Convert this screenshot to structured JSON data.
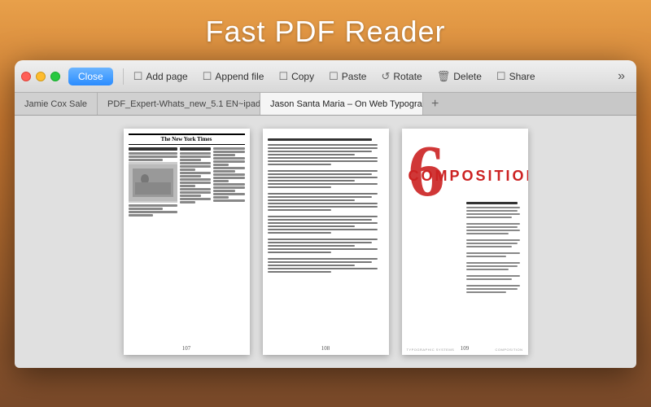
{
  "appTitle": "Fast PDF Reader",
  "toolbar": {
    "closeBtn": "Close",
    "buttons": [
      {
        "id": "add-page",
        "icon": "☐",
        "label": "Add page"
      },
      {
        "id": "append-file",
        "icon": "☐",
        "label": "Append file"
      },
      {
        "id": "copy",
        "icon": "☐",
        "label": "Copy"
      },
      {
        "id": "paste",
        "icon": "☐",
        "label": "Paste"
      },
      {
        "id": "rotate",
        "icon": "↺",
        "label": "Rotate"
      },
      {
        "id": "delete",
        "icon": "🗑",
        "label": "Delete"
      },
      {
        "id": "share",
        "icon": "☐",
        "label": "Share"
      }
    ],
    "moreIcon": "»"
  },
  "tabs": [
    {
      "id": "tab1",
      "label": "Jamie Cox Sale",
      "active": false,
      "closeable": false
    },
    {
      "id": "tab2",
      "label": "PDF_Expert-Whats_new_5.1 EN~ipad",
      "active": false,
      "closeable": true
    },
    {
      "id": "tab3",
      "label": "Jason Santa Maria – On Web Typogra...",
      "active": true,
      "closeable": true
    }
  ],
  "pages": [
    {
      "id": "page107",
      "number": "107",
      "type": "newspaper",
      "header": "The New York Times"
    },
    {
      "id": "page108",
      "number": "108",
      "type": "text",
      "chapterLabel": "ON WEB TYPOGRAPHY"
    },
    {
      "id": "page109",
      "number": "109",
      "type": "composition",
      "bigNumber": "6",
      "title": "COMPOSITION",
      "footerLeft": "TYPOGRAPHIC SYSTEMS",
      "footerRight": "COMPOSITION"
    }
  ]
}
